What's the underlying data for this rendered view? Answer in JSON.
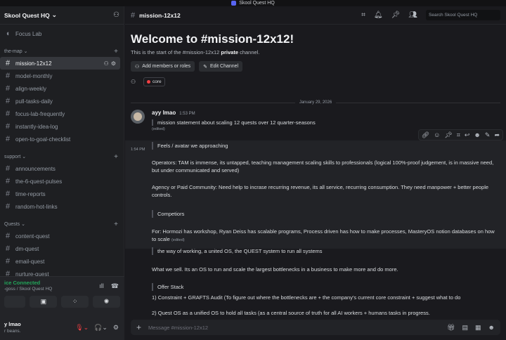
{
  "window": {
    "title": "Skool Quest HQ"
  },
  "server": {
    "name": "Skool Quest HQ"
  },
  "sidebar": {
    "top_channel": "Focus Lab",
    "categories": [
      {
        "name": "the-map",
        "channels": [
          "mission-12x12",
          "model-monthly",
          "align-weekly",
          "pull-tasks-daily",
          "focus-lab-frequently",
          "instantly-idea-log",
          "open-to-goal-checklist"
        ]
      },
      {
        "name": "support",
        "channels": [
          "announcements",
          "the-6-quest-pulses",
          "time-reports",
          "random-hot-links"
        ]
      },
      {
        "name": "Quests",
        "channels": [
          "content-quest",
          "dm-quest",
          "email-quest",
          "nurture-quest"
        ]
      }
    ],
    "active_channel": "mission-12x12"
  },
  "voice": {
    "status": "ice Connected",
    "location": "-goss / Skool Quest HQ"
  },
  "user": {
    "name": "y lmao",
    "status": "r beans."
  },
  "header": {
    "channel": "mission-12x12",
    "search_placeholder": "Search Skool Quest HQ"
  },
  "welcome": {
    "title": "Welcome to #mission-12x12!",
    "sub_prefix": "This is the start of the #mission-12x12 ",
    "sub_bold": "private",
    "sub_suffix": " channel.",
    "add_members": "Add members or roles",
    "edit_channel": "Edit Channel",
    "role": "core"
  },
  "date_divider": "January 29, 2026",
  "message": {
    "author": "ayy lmao",
    "time": "1:53 PM",
    "quote": "mission statement about scaling 12 quests over 12 quarter-seasons",
    "edited": "(edited)",
    "time2": "1:54 PM",
    "lines": {
      "h1": "Feels / avatar we approaching",
      "p1": "Operators: TAM is immense, its untapped, teaching management scaling skills to professionals (logical 100%-proof judgement, is in massive need, but under communicated and served)",
      "p2": "Agency or Paid Community: Need help to incrase recurring revenue, its all service, recurring consumption. They need manpower + better people controls.",
      "h2": "Competiors",
      "p3": "For: Hormozi has workshop, Ryan Deiss has scalable programs, Process driven has how to make processes, MasteryOS notion databases on how to scale",
      "p3_edited": "(edited)",
      "q3": "the way of working, a united OS, the QUEST system to run all systems",
      "p4": "What we sell. Its an OS to run and scale the largest bottlenecks in a business to make more and do more.",
      "h3": "Offer Stack",
      "p5": "1) Constraint + GRAFTS Audit (To figure out where the bottlenecks are + the company's current core constraint + suggest what to do",
      "p6": "2) Quest OS as a unified OS to hold all tasks (as a central source of truth for all AI workers + humans tasks in progress."
    }
  },
  "composer": {
    "placeholder": "Message #mission-12x12"
  }
}
